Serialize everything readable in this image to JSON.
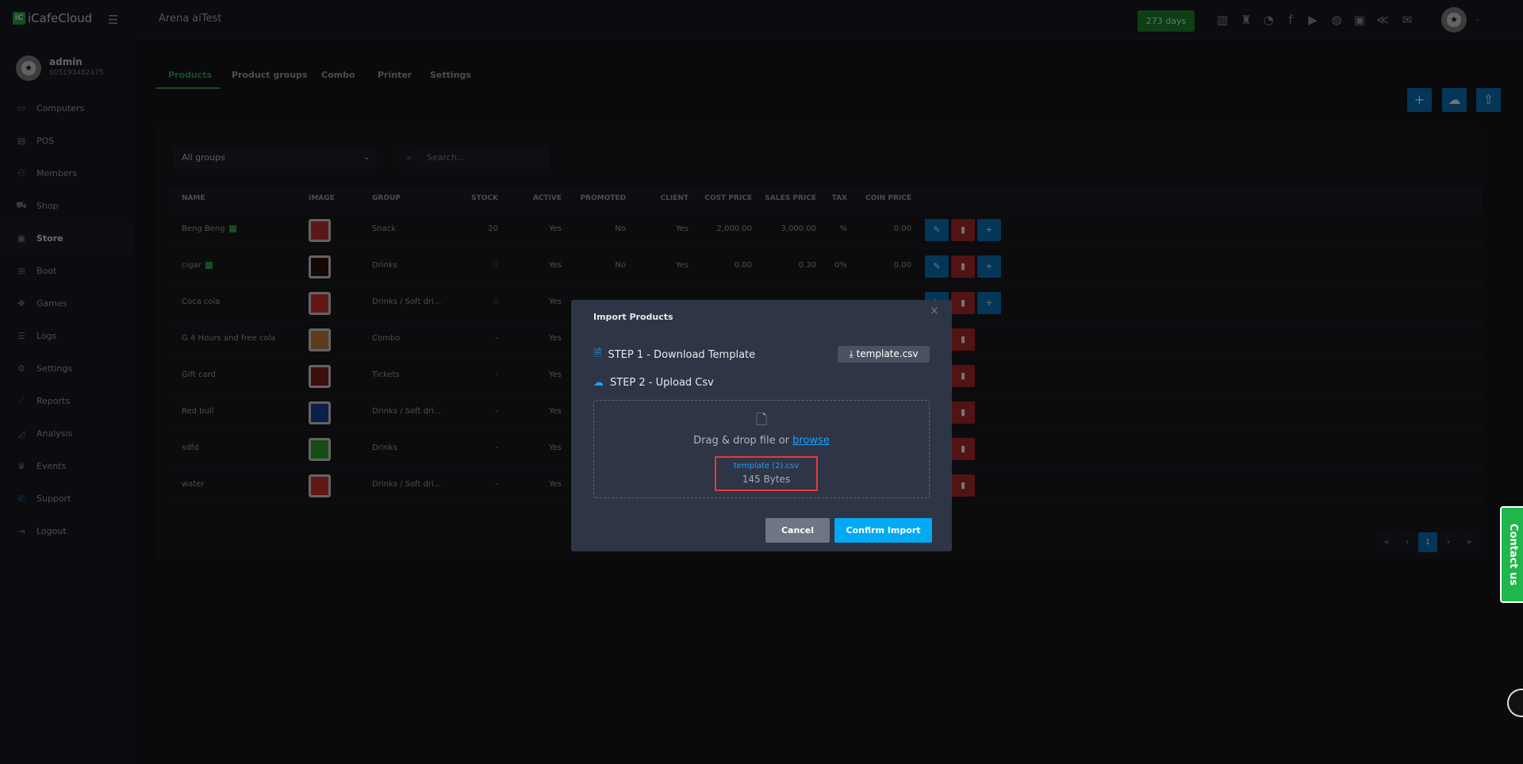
{
  "app": {
    "logo": "iCafeCloud",
    "center_name": "Arena aiTest",
    "days": "273 days"
  },
  "user": {
    "name": "admin",
    "id": "005193482475"
  },
  "sidebar": {
    "items": [
      {
        "label": "Computers",
        "icon": "monitor-icon"
      },
      {
        "label": "POS",
        "icon": "cash-register-icon"
      },
      {
        "label": "Members",
        "icon": "users-icon"
      },
      {
        "label": "Shop",
        "icon": "cart-icon"
      },
      {
        "label": "Store",
        "icon": "bag-icon"
      },
      {
        "label": "Boot",
        "icon": "windows-icon"
      },
      {
        "label": "Games",
        "icon": "gamepad-icon"
      },
      {
        "label": "Logs",
        "icon": "list-icon"
      },
      {
        "label": "Settings",
        "icon": "gear-icon"
      },
      {
        "label": "Reports",
        "icon": "chart-line-icon"
      },
      {
        "label": "Analysis",
        "icon": "chart-area-icon"
      },
      {
        "label": "Events",
        "icon": "crown-icon"
      },
      {
        "label": "Support",
        "icon": "phone-icon"
      },
      {
        "label": "Logout",
        "icon": "logout-icon"
      }
    ]
  },
  "tabs": [
    "Products",
    "Product groups",
    "Combo",
    "Printer",
    "Settings"
  ],
  "filter": {
    "group": "All groups",
    "search_placeholder": "Search..."
  },
  "table": {
    "headers": [
      "NAME",
      "IMAGE",
      "GROUP",
      "STOCK",
      "ACTIVE",
      "PROMOTED",
      "CLIENT",
      "COST PRICE",
      "SALES PRICE",
      "TAX",
      "COIN PRICE"
    ],
    "rows": [
      {
        "name": "Beng Beng",
        "group": "Snack",
        "stock": "20",
        "active": "Yes",
        "promoted": "No",
        "client": "Yes",
        "cost": "2,000.00",
        "sales": "3,000.00",
        "tax": "%",
        "coin": "0.00"
      },
      {
        "name": "cigar",
        "group": "Drinks",
        "stock": "0",
        "active": "Yes",
        "promoted": "No",
        "client": "Yes",
        "cost": "0.00",
        "sales": "0.30",
        "tax": "0%",
        "coin": "0.00"
      },
      {
        "name": "Coca cola",
        "group": "Drinks / Soft dri...",
        "stock": "0",
        "active": "Yes"
      },
      {
        "name": "G 4 Hours and free cola",
        "group": "Combo",
        "stock": "-",
        "active": "Yes"
      },
      {
        "name": "Gift card",
        "group": "Tickets",
        "stock": "-",
        "active": "Yes"
      },
      {
        "name": "Red bull",
        "group": "Drinks / Soft dri...",
        "stock": "-",
        "active": "Yes"
      },
      {
        "name": "sdfd",
        "group": "Drinks",
        "stock": "-",
        "active": "Yes"
      },
      {
        "name": "water",
        "group": "Drinks / Soft dri...",
        "stock": "-",
        "active": "Yes"
      }
    ]
  },
  "pagination": {
    "first": "«",
    "prev": "‹",
    "current": "1",
    "next": "›",
    "last": "»"
  },
  "contact": "Contact us",
  "modal": {
    "title": "Import Products",
    "close": "×",
    "step1": "STEP 1 - Download Template",
    "template_btn": "template.csv",
    "step2": "STEP 2 - Upload Csv",
    "drop_text": "Drag & drop file or ",
    "browse": "browse",
    "file_name": "template (2).csv",
    "file_size": "145 Bytes",
    "cancel": "Cancel",
    "confirm": "Confirm Import"
  },
  "colors": {
    "accent": "#2eae4a",
    "primary": "#0a78c2",
    "danger": "#b42a2a",
    "confirm": "#04a9f4"
  }
}
